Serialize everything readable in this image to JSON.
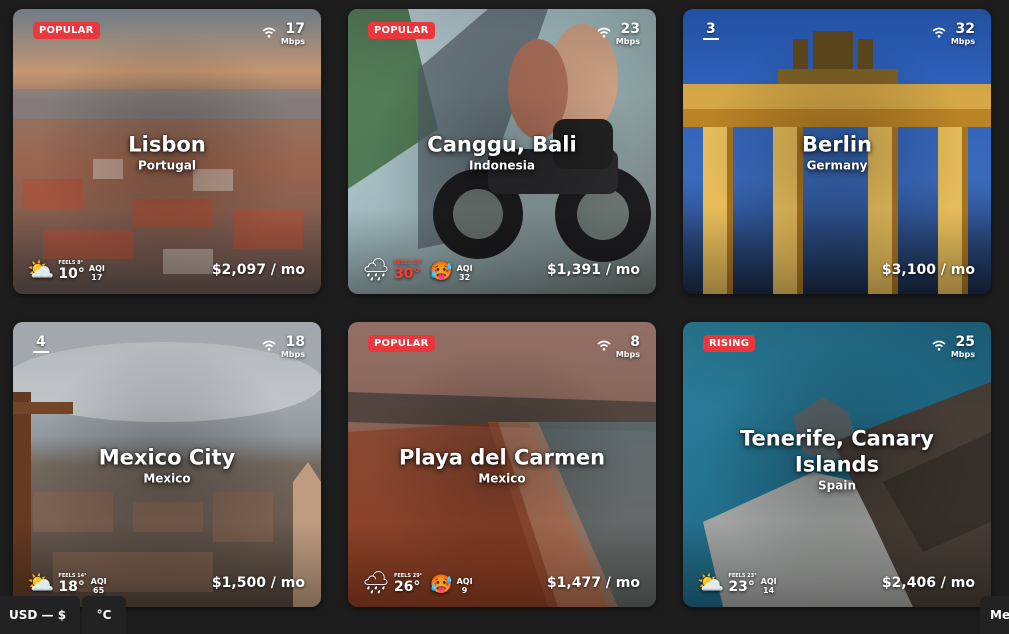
{
  "cards": [
    {
      "city": "Lisbon",
      "country": "Portugal",
      "badge": "POPULAR",
      "rank": "",
      "wifi": "17",
      "wifi_unit": "Mbps",
      "feels": "FEELS 8°",
      "temp": "10°",
      "hot": false,
      "aqi_label": "AQI",
      "aqi": "17",
      "price": "$2,097 / mo",
      "weather_icon": "cloud-sun-icon"
    },
    {
      "city": "Canggu, Bali",
      "country": "Indonesia",
      "badge": "POPULAR",
      "rank": "",
      "wifi": "23",
      "wifi_unit": "Mbps",
      "feels": "FEELS 37°",
      "temp": "30°",
      "hot": true,
      "aqi_label": "AQI",
      "aqi": "32",
      "price": "$1,391 / mo",
      "weather_icon": "rain-cloud-icon"
    },
    {
      "city": "Berlin",
      "country": "Germany",
      "badge": "",
      "rank": "3",
      "wifi": "32",
      "wifi_unit": "Mbps",
      "feels": "",
      "temp": "",
      "hot": false,
      "aqi_label": "",
      "aqi": "",
      "price": "$3,100 / mo",
      "weather_icon": ""
    },
    {
      "city": "Mexico City",
      "country": "Mexico",
      "badge": "",
      "rank": "4",
      "wifi": "18",
      "wifi_unit": "Mbps",
      "feels": "FEELS 14°",
      "temp": "18°",
      "hot": false,
      "aqi_label": "AQI",
      "aqi": "65",
      "price": "$1,500 / mo",
      "weather_icon": "cloud-sun-icon"
    },
    {
      "city": "Playa del Carmen",
      "country": "Mexico",
      "badge": "POPULAR",
      "rank": "",
      "wifi": "8",
      "wifi_unit": "Mbps",
      "feels": "FEELS 29°",
      "temp": "26°",
      "hot": false,
      "aqi_label": "AQI",
      "aqi": "9",
      "price": "$1,477 / mo",
      "weather_icon": "rain-cloud-icon"
    },
    {
      "city": "Tenerife, Canary Islands",
      "country": "Spain",
      "badge": "RISING",
      "rank": "",
      "wifi": "25",
      "wifi_unit": "Mbps",
      "feels": "FEELS 23°",
      "temp": "23°",
      "hot": false,
      "aqi_label": "AQI",
      "aqi": "14",
      "price": "$2,406 / mo",
      "weather_icon": "cloud-sun-icon"
    }
  ],
  "footer": {
    "currency": "USD — $",
    "unit": "°C",
    "menu": "Me"
  },
  "colors": {
    "badge": "#e8383d",
    "background": "#1c1c1c",
    "hot_temp": "#ff3b30"
  }
}
